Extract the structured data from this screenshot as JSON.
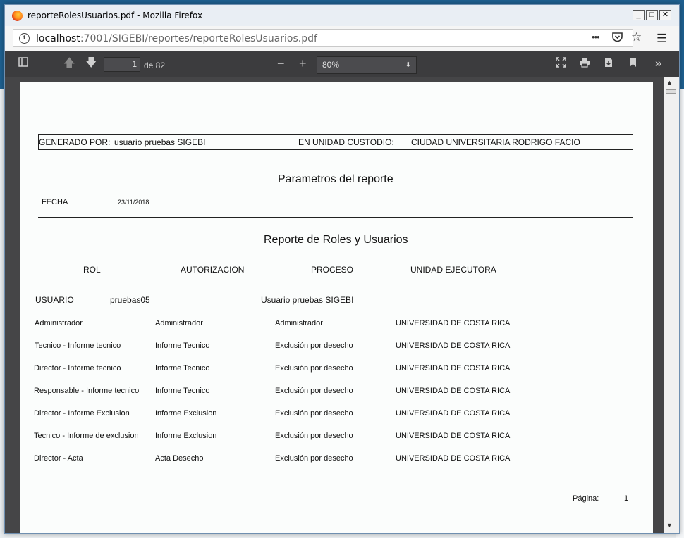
{
  "window": {
    "title": "reporteRolesUsuarios.pdf - Mozilla Firefox",
    "minimize": "_",
    "maximize": "□",
    "close": "✕"
  },
  "urlbar": {
    "host": "localhost",
    "path": ":7001/SIGEBI/reportes/reporteRolesUsuarios.pdf",
    "more_icon": "•••",
    "pocket_icon": "pocket-icon",
    "bookmark_icon": "star-icon",
    "menu_icon": "☰"
  },
  "pdf_toolbar": {
    "page_number": "1",
    "page_of": "de 82",
    "zoom": "80%"
  },
  "report": {
    "generado_label": "GENERADO POR:",
    "generado_value": "usuario pruebas SIGEBI",
    "unidad_label": "EN UNIDAD CUSTODIO:",
    "unidad_value": "CIUDAD UNIVERSITARIA RODRIGO FACIO",
    "params_title": "Parametros del reporte",
    "fecha_label": "FECHA",
    "fecha_value": "23/11/2018",
    "report_title": "Reporte de Roles y Usuarios",
    "columns": [
      "ROL",
      "AUTORIZACION",
      "PROCESO",
      "UNIDAD EJECUTORA"
    ],
    "usuario_label": "USUARIO",
    "usuario_id": "pruebas05",
    "usuario_name": "Usuario pruebas SIGEBI",
    "rows": [
      [
        "Administrador",
        "Administrador",
        "Administrador",
        "UNIVERSIDAD DE COSTA RICA"
      ],
      [
        "Tecnico -  Informe tecnico",
        "Informe Tecnico",
        "Exclusión por desecho",
        "UNIVERSIDAD DE COSTA RICA"
      ],
      [
        "Director - Informe tecnico",
        "Informe Tecnico",
        "Exclusión por desecho",
        "UNIVERSIDAD DE COSTA RICA"
      ],
      [
        "Responsable - Informe tecnico",
        "Informe Tecnico",
        "Exclusión por desecho",
        "UNIVERSIDAD DE COSTA RICA"
      ],
      [
        "Director - Informe Exclusion",
        "Informe Exclusion",
        "Exclusión por desecho",
        "UNIVERSIDAD DE COSTA RICA"
      ],
      [
        "Tecnico - Informe de exclusion",
        "Informe Exclusion",
        "Exclusión por desecho",
        "UNIVERSIDAD DE COSTA RICA"
      ],
      [
        "Director  -  Acta",
        "Acta Desecho",
        "Exclusión por desecho",
        "UNIVERSIDAD DE COSTA RICA"
      ]
    ],
    "pagina_label": "Página:",
    "pagina_value": "1"
  }
}
